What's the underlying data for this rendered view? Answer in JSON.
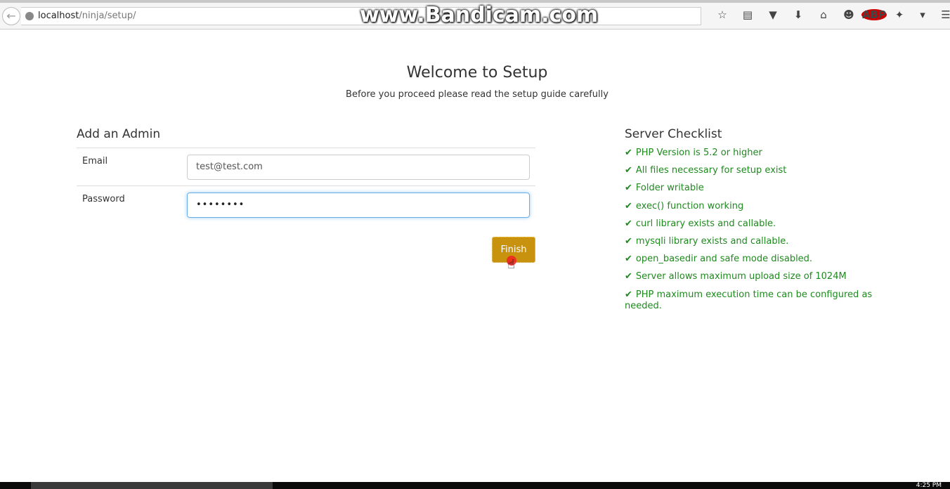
{
  "browser": {
    "url_host": "localhost",
    "url_path": "/ninja/setup/",
    "watermark": "www.Bandicam.com",
    "toolbar_icons": [
      "star-icon",
      "reading-list-icon",
      "pocket-icon",
      "download-icon",
      "home-icon",
      "chat-icon",
      "adblock-icon",
      "extension-icon",
      "dropdown-icon",
      "menu-icon"
    ],
    "adblock_label": "ABP"
  },
  "page": {
    "title": "Welcome to Setup",
    "subtitle": "Before you proceed please read the setup guide carefully"
  },
  "admin": {
    "heading": "Add an Admin",
    "email_label": "Email",
    "email_value": "test@test.com",
    "password_label": "Password",
    "password_value": "••••••••",
    "finish_label": "Finish",
    "button_color": "#c8920f"
  },
  "checklist": {
    "heading": "Server Checklist",
    "color": "#1e8a1e",
    "items": [
      "PHP Version is 5.2 or higher",
      "All files necessary for setup exist",
      "Folder writable",
      "exec() function working",
      "curl library exists and callable.",
      "mysqli library exists and callable.",
      "open_basedir and safe mode disabled.",
      "Server allows maximum upload size of 1024M",
      "PHP maximum execution time can be configured as needed."
    ]
  },
  "taskbar": {
    "clock": "4:25 PM"
  }
}
